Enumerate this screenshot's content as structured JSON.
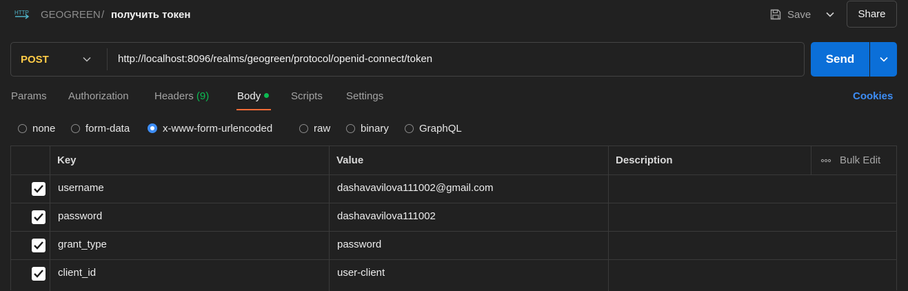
{
  "header": {
    "protocol_icon": "http-icon",
    "protocol_badge": "HTTP",
    "collection": "GEOGREEN",
    "separator": "/",
    "request_name": "получить токен",
    "save_label": "Save",
    "share_label": "Share"
  },
  "request": {
    "method": "POST",
    "url": "http://localhost:8096/realms/geogreen/protocol/openid-connect/token",
    "send_label": "Send"
  },
  "tabs": {
    "params": "Params",
    "authorization": "Authorization",
    "headers": "Headers",
    "headers_count": "(9)",
    "body": "Body",
    "scripts": "Scripts",
    "settings": "Settings",
    "active": "Body",
    "cookies": "Cookies"
  },
  "body_modes": {
    "none": "none",
    "form_data": "form-data",
    "urlencoded": "x-www-form-urlencoded",
    "raw": "raw",
    "binary": "binary",
    "graphql": "GraphQL",
    "selected": "x-www-form-urlencoded"
  },
  "table": {
    "headers": {
      "key": "Key",
      "value": "Value",
      "description": "Description",
      "bulk_edit": "Bulk Edit"
    },
    "rows": [
      {
        "checked": true,
        "key": "username",
        "value": "dashavavilova111002@gmail.com",
        "description": ""
      },
      {
        "checked": true,
        "key": "password",
        "value": "dashavavilova111002",
        "description": ""
      },
      {
        "checked": true,
        "key": "grant_type",
        "value": "password",
        "description": ""
      },
      {
        "checked": true,
        "key": "client_id",
        "value": "user-client",
        "description": ""
      }
    ]
  },
  "colors": {
    "method": "#ffcb47",
    "send": "#0b6fd8",
    "active_tab_underline": "#ff6c37",
    "status_green": "#0cbb52",
    "link_blue": "#3d8df5"
  }
}
